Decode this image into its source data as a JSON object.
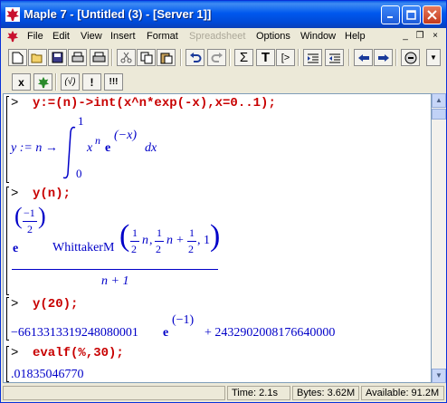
{
  "window": {
    "title": "Maple 7  - [Untitled (3) - [Server 1]]"
  },
  "menu": {
    "items": [
      "File",
      "Edit",
      "View",
      "Insert",
      "Format",
      "Spreadsheet",
      "Options",
      "Window",
      "Help"
    ],
    "disabled": [
      "Spreadsheet"
    ]
  },
  "toolbar2": {
    "btn_x": "x",
    "btn_sqrt": "(√)",
    "btn_bang": "!",
    "btn_bangs": "!!!"
  },
  "worksheet": {
    "prompt": ">",
    "inputs": [
      "y:=(n)->int(x^n*exp(-x),x=0..1);",
      "y(n);",
      "y(20);",
      "evalf(%,30);"
    ],
    "out1": {
      "lhs": "y := n → ",
      "upper": "1",
      "lower": "0",
      "base": "x",
      "exp_n": "n",
      "e": "e",
      "exp_arg": "(−x)",
      "dx": "dx"
    },
    "out2": {
      "e": "e",
      "frac_num": "−1",
      "frac_den": "2",
      "func": "WhittakerM",
      "half_num": "1",
      "half_den": "2",
      "n": "n",
      "comma": ",",
      "one": "1",
      "plus": "+",
      "den": "n + 1"
    },
    "out3": {
      "term1": "−6613313319248080001 ",
      "e": "e",
      "exp": "(−1)",
      "term2": " + 2432902008176640000"
    },
    "out4": ".01835046770"
  },
  "status": {
    "time": "Time:  2.1s",
    "bytes": "Bytes: 3.62M",
    "available": "Available: 91.2M"
  }
}
